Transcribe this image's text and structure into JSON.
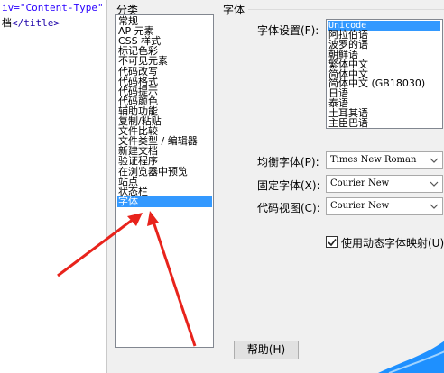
{
  "code_editor": {
    "line1": "iv=\"Content-Type\"",
    "line2_text": "档",
    "line2_tag": "</title>"
  },
  "dialog": {
    "category_header": "分类",
    "categories": [
      "常规",
      "AP 元素",
      "CSS 样式",
      "标记色彩",
      "不可见元素",
      "代码改写",
      "代码格式",
      "代码提示",
      "代码颜色",
      "辅助功能",
      "复制/粘贴",
      "文件比较",
      "文件类型 / 编辑器",
      "新建文档",
      "验证程序",
      "在浏览器中预览",
      "站点",
      "状态栏",
      "字体"
    ],
    "selected_category": "字体",
    "panel_title": "字体",
    "encoding_label": "字体设置(F):",
    "encodings": [
      "Unicode",
      "阿拉伯语",
      "波罗的语",
      "朝鲜语",
      "繁体中文",
      "简体中文",
      "简体中文 (GB18030)",
      "日语",
      "泰语",
      "土耳其语",
      "主臣巴语"
    ],
    "selected_encoding": "Unicode",
    "proportional_label": "均衡字体(P):",
    "proportional_value": "Times New Roman",
    "fixed_label": "固定字体(X):",
    "fixed_value": "Courier New",
    "code_view_label": "代码视图(C):",
    "code_view_value": "Courier New",
    "dynamic_font_label": "使用动态字体映射(U)",
    "dynamic_font_checked": true,
    "help_button": "帮助(H)"
  },
  "colors": {
    "selection": "#3399ff",
    "arrow": "#e8231c",
    "wave": "#1e90ff"
  },
  "icons": [
    "chevron-down-icon",
    "checkmark-icon"
  ]
}
